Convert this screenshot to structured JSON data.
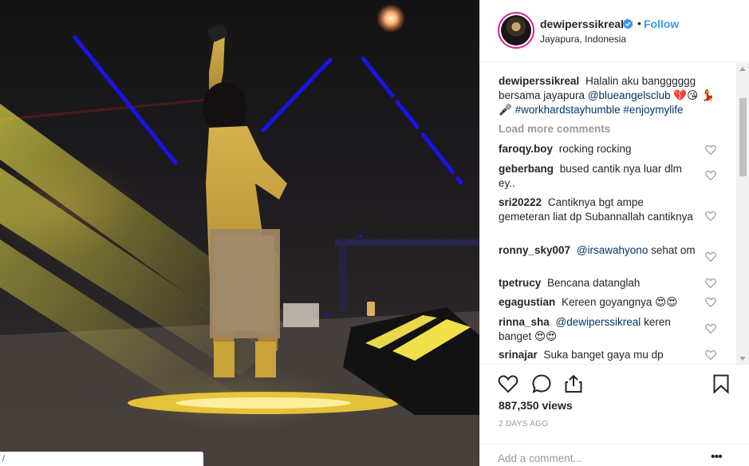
{
  "post": {
    "username": "dewiperssikreal",
    "location": "Jayapura, Indonesia",
    "follow_label": "Follow",
    "separator": "•",
    "caption": {
      "username": "dewiperssikreal",
      "text_1": "Halalin aku bangggggg bersama jayapura",
      "mention": "@blueangelsclub",
      "emojis_1": "💔😘",
      "emojis_2": "💃🎤",
      "hashtag_1": "#workhardstayhumble",
      "hashtag_2": "#enjoymylife"
    },
    "load_more_label": "Load more comments",
    "comments": [
      {
        "user": "faroqy.boy",
        "text": "rocking rocking"
      },
      {
        "user": "geberbang",
        "text": "bused cantik nya luar dlm ey.."
      },
      {
        "user": "sri20222",
        "text": "Cantiknya bgt ampe gemeteran liat dp Subannallah cantiknya"
      },
      {
        "user": "ronny_sky007",
        "mention": "@irsawahyono",
        "text": "sehat om"
      },
      {
        "user": "tpetrucy",
        "text": "Bencana datanglah"
      },
      {
        "user": "egagustian",
        "text": "Kereen goyangnya 😍😍"
      },
      {
        "user": "rinna_sha",
        "mention": "@dewiperssikreal",
        "text": "keren banget 😍😍"
      },
      {
        "user": "srinajar",
        "text": "Suka banget gaya mu dp"
      }
    ],
    "views": "887,350 views",
    "time_ago": "2 DAYS AGO",
    "add_comment_placeholder": "Add a comment...",
    "more_label": "•••"
  },
  "media": {
    "corner_text": "/"
  },
  "colors": {
    "link": "#003569",
    "follow": "#3897f0",
    "verified": "#3897f0",
    "muted": "#999999",
    "blue_marks": "#1a12e6",
    "yellow_beam": "#f4e23a"
  },
  "icons": [
    "verified-badge-icon",
    "heart-icon",
    "comment-icon",
    "share-icon",
    "bookmark-icon",
    "more-icon"
  ]
}
